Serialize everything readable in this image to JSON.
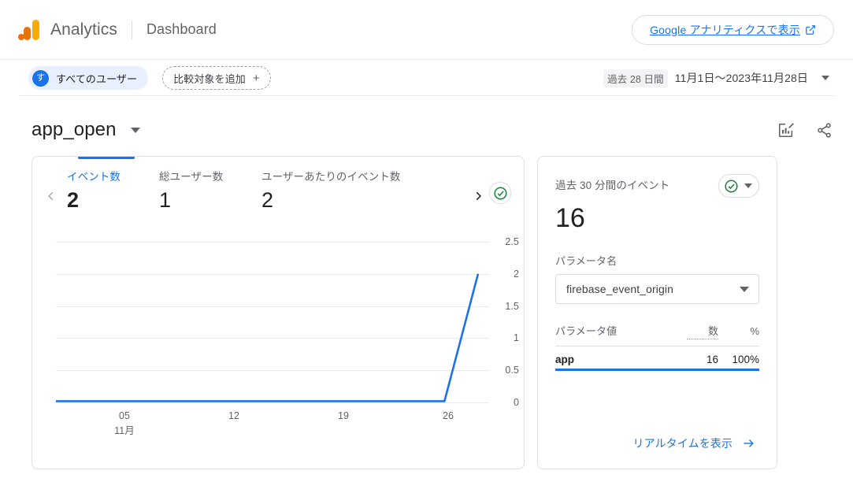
{
  "topbar": {
    "logo_icon": "google-analytics-logo",
    "brand": "Analytics",
    "page": "Dashboard",
    "view_button": {
      "label": "Google アナリティクスで表示",
      "icon": "external-link-icon"
    }
  },
  "filterbar": {
    "audience": {
      "avatar_initial": "す",
      "label": "すべてのユーザー"
    },
    "compare": {
      "label": "比較対象を追加",
      "icon": "plus-icon"
    },
    "daterange": {
      "pill": "過去 28 日間",
      "text": "11月1日〜2023年11月28日",
      "icon": "chevron-down-icon"
    }
  },
  "heading": {
    "title": "app_open",
    "dropdown_icon": "chevron-down-icon",
    "actions": [
      {
        "name": "edit-chart-icon"
      },
      {
        "name": "share-icon"
      }
    ]
  },
  "left_card": {
    "prev_icon": "chevron-left-icon",
    "next_icon": "chevron-right-icon",
    "status_icon": "check-circle-icon",
    "metrics": [
      {
        "label": "イベント数",
        "value": "2",
        "active": true
      },
      {
        "label": "総ユーザー数",
        "value": "1",
        "active": false
      },
      {
        "label": "ユーザーあたりのイベント数",
        "value": "2",
        "active": false
      }
    ]
  },
  "right_card": {
    "title": "過去 30 分間のイベント",
    "status_icon": "check-circle-icon",
    "status_caret_icon": "chevron-down-icon",
    "value": "16",
    "param_name_label": "パラメータ名",
    "param_name_value": "firebase_event_origin",
    "table": {
      "headers": [
        "パラメータ値",
        "数",
        "%"
      ],
      "rows": [
        {
          "value": "app",
          "count": "16",
          "pct": "100%"
        }
      ]
    },
    "footer_link": {
      "label": "リアルタイムを表示",
      "icon": "arrow-right-icon"
    }
  },
  "colors": {
    "accent_blue": "#1a73e8",
    "green": "#188038",
    "logo_orange": "#e8710a",
    "logo_yellow": "#f9ab00",
    "grid": "#e8eaed"
  },
  "chart_data": {
    "type": "line",
    "title": "app_open イベント数",
    "xlabel": "",
    "ylabel": "",
    "ylim": [
      0,
      2.5
    ],
    "grid": true,
    "legend": "none",
    "series": [
      {
        "name": "イベント数",
        "color": "#1a73e8",
        "x": [
          1,
          2,
          3,
          4,
          5,
          6,
          7,
          8,
          9,
          10,
          11,
          12,
          13,
          14,
          15,
          16,
          17,
          18,
          19,
          20,
          21,
          22,
          23,
          24,
          25,
          26,
          27,
          28
        ],
        "values": [
          0,
          0,
          0,
          0,
          0,
          0,
          0,
          0,
          0,
          0,
          0,
          0,
          0,
          0,
          0,
          0,
          0,
          0,
          0,
          0,
          0,
          0,
          0,
          0,
          0,
          0,
          0,
          2
        ]
      }
    ],
    "ytick_labels": [
      "2.5",
      "2",
      "1.5",
      "1",
      "0.5",
      "0"
    ],
    "ytick_values": [
      2.5,
      2,
      1.5,
      1,
      0.5,
      0
    ],
    "xtick_labels": [
      "05",
      "12",
      "19",
      "26"
    ],
    "xtick_values": [
      5,
      12,
      19,
      26
    ],
    "xtick_sublabel": "11月"
  }
}
